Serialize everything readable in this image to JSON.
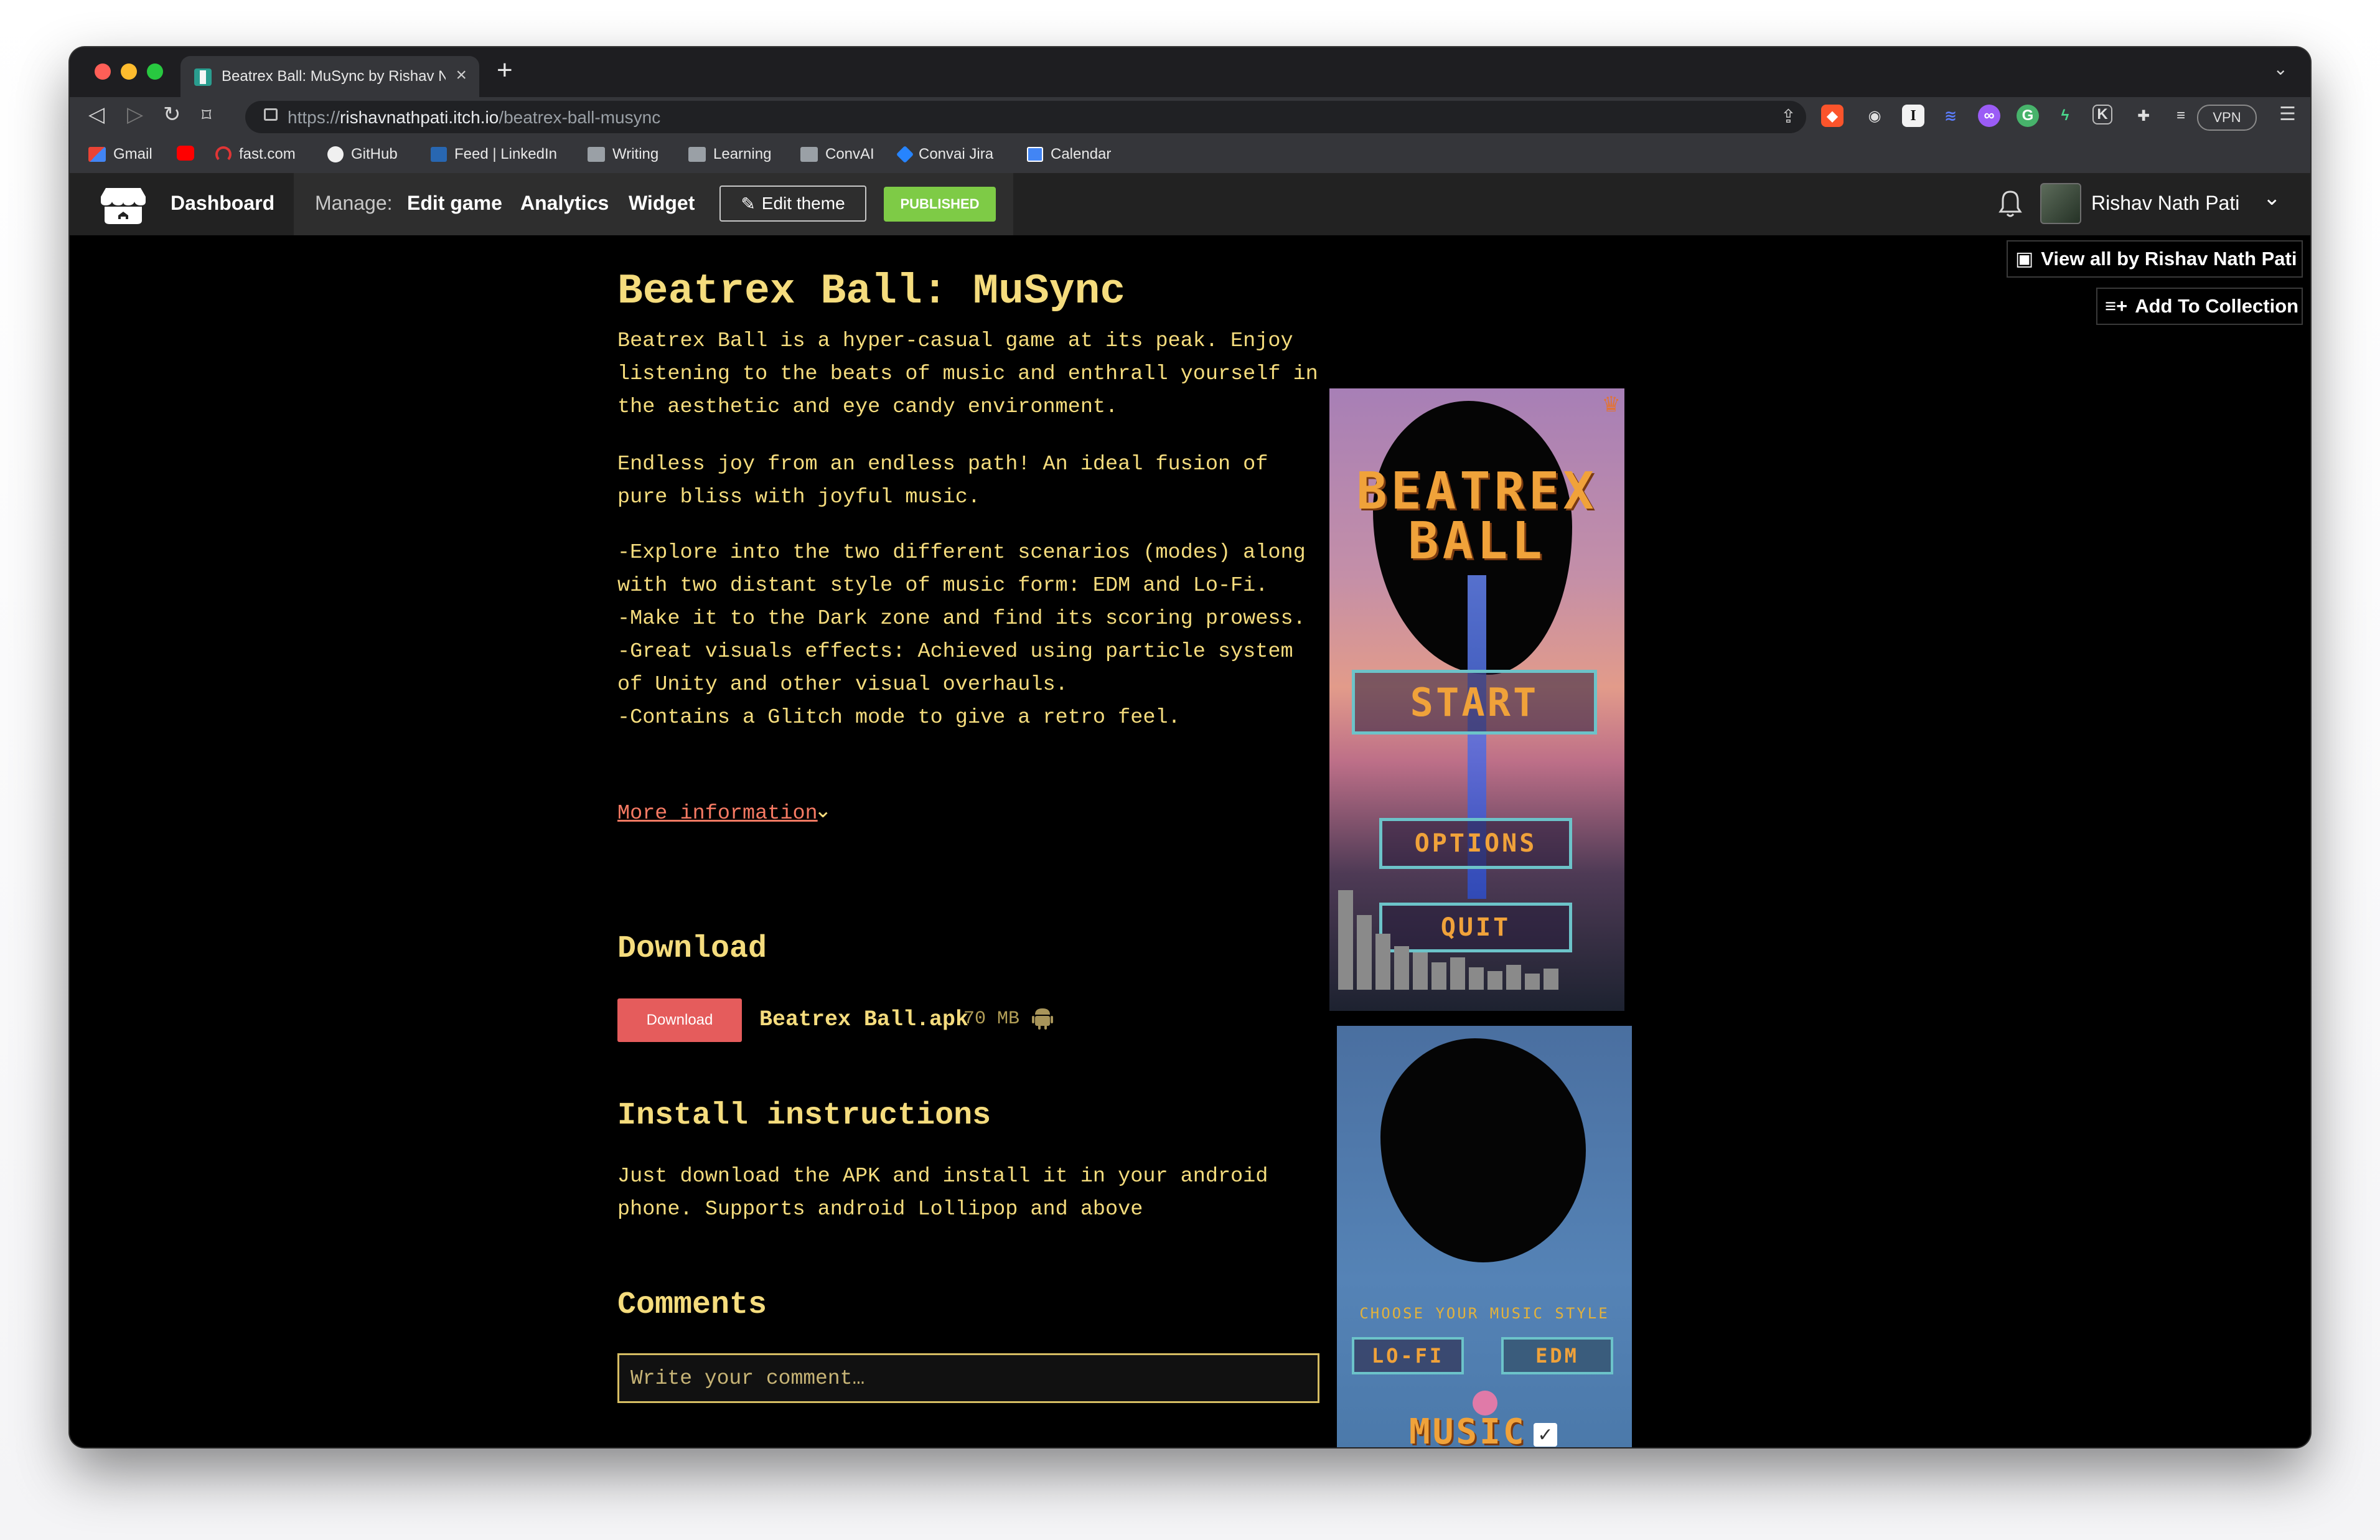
{
  "browser": {
    "tab_title": "Beatrex Ball: MuSync by Rishav Nath Pati",
    "new_tab": "+",
    "url_scheme": "https://",
    "url_host": "rishavnathpati.itch.io",
    "url_path": "/beatrex-ball-musync",
    "vpn_label": "VPN",
    "bookmarks": [
      {
        "label": "Gmail",
        "icon": "gmail-icon"
      },
      {
        "label": "",
        "icon": "youtube-icon"
      },
      {
        "label": "fast.com",
        "icon": "fast-icon"
      },
      {
        "label": "GitHub",
        "icon": "github-icon"
      },
      {
        "label": "Feed | LinkedIn",
        "icon": "linkedin-icon"
      },
      {
        "label": "Writing",
        "icon": "folder-icon"
      },
      {
        "label": "Learning",
        "icon": "folder-icon"
      },
      {
        "label": "ConvAI",
        "icon": "folder-icon"
      },
      {
        "label": "Convai Jira",
        "icon": "jira-icon"
      },
      {
        "label": "Calendar",
        "icon": "calendar-icon"
      }
    ]
  },
  "itch_header": {
    "dashboard": "Dashboard",
    "manage_label": "Manage:",
    "edit_game": "Edit game",
    "analytics": "Analytics",
    "widget": "Widget",
    "edit_theme": "Edit theme",
    "published": "PUBLISHED",
    "user_name": "Rishav Nath Pati"
  },
  "game": {
    "title": "Beatrex Ball: MuSync",
    "description": [
      "Beatrex Ball is a hyper-casual game at its peak. Enjoy listening to the beats of music and enthrall yourself in the aesthetic and eye candy environment.",
      "Endless joy from an endless path! An ideal fusion of pure bliss with joyful music.",
      "-Explore into the two different scenarios (modes) along with two distant style of music form: EDM and Lo-Fi.",
      "-Make it to the Dark zone and find its scoring prowess.",
      "-Great visuals effects: Achieved using particle system of Unity and other visual overhauls.",
      "-Contains a Glitch mode to give a retro feel."
    ],
    "more_information": "More information",
    "download_heading": "Download",
    "download_button": "Download",
    "file_name": "Beatrex Ball.apk",
    "file_size": "70 MB",
    "install_heading": "Install instructions",
    "install_text": "Just download the APK and install it in your android phone. Supports android Lollipop and above",
    "comments_heading": "Comments",
    "comment_placeholder": "Write your comment…"
  },
  "sidebar": {
    "view_all": "View all by Rishav Nath Pati",
    "add_to_collection": "Add To Collection"
  },
  "screenshots": {
    "shot1": {
      "title_line1": "BEATREX",
      "title_line2": "BALL",
      "start": "START",
      "options": "OPTIONS",
      "quit": "QUIT"
    },
    "shot2": {
      "choose_style": "CHOOSE YOUR MUSIC STYLE",
      "lofi": "LO-FI",
      "edm": "EDM",
      "music": "MUSIC"
    }
  },
  "colors": {
    "accent_text": "#f5dc7d",
    "link": "#f77a63",
    "download_button": "#e55c5c",
    "published_badge": "#7ecb46",
    "page_bg": "#000000"
  }
}
